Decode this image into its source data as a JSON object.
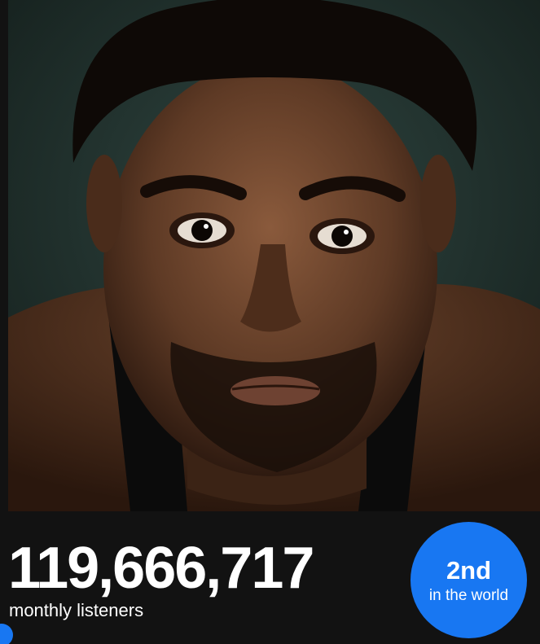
{
  "stats": {
    "monthly_listeners": "119,666,717",
    "monthly_listeners_label": "monthly listeners",
    "rank": "2nd",
    "rank_caption": "in the world"
  },
  "colors": {
    "background": "#121212",
    "accent": "#1877f2",
    "text": "#ffffff"
  }
}
